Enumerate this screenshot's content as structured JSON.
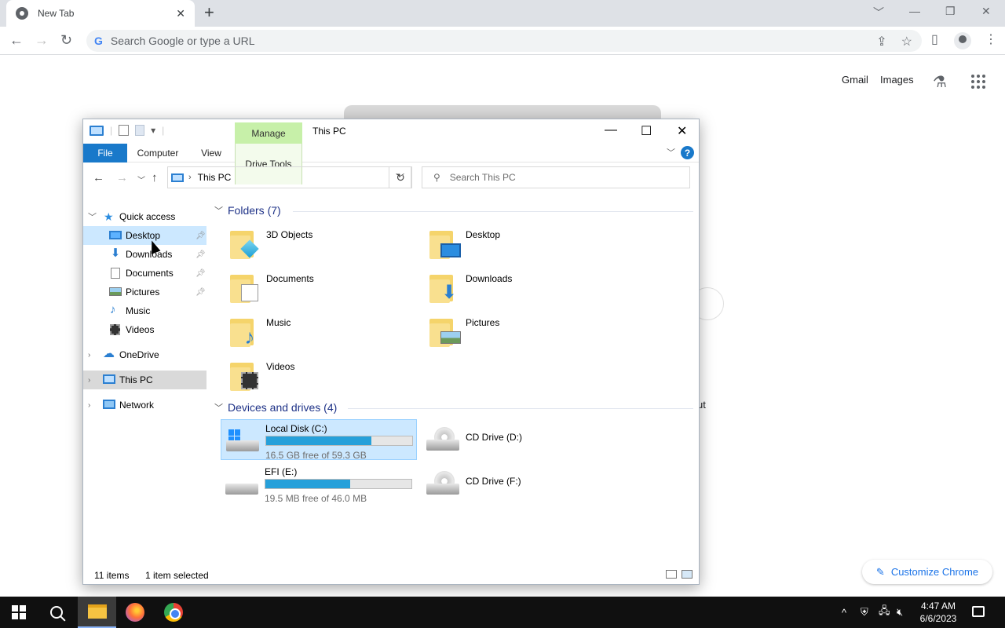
{
  "browser": {
    "tab_title": "New Tab",
    "tab_close": "✕",
    "new_tab": "+",
    "omnibox_placeholder": "Search Google or type a URL",
    "omnibox_g": "G",
    "links": {
      "gmail": "Gmail",
      "images": "Images"
    },
    "customize_label": "Customize Chrome",
    "partial_text": "ut"
  },
  "explorer": {
    "window_title": "This PC",
    "manage_tab": "Manage",
    "ribbon_tabs": {
      "file": "File",
      "computer": "Computer",
      "view": "View",
      "drive_tools": "Drive Tools"
    },
    "help": "?",
    "address": "This PC",
    "search_placeholder": "Search This PC",
    "nav": {
      "quick_access": "Quick access",
      "quick_items": [
        {
          "label": "Desktop",
          "icon": "desktop-icon",
          "pinned": true
        },
        {
          "label": "Downloads",
          "icon": "downloads-icon",
          "pinned": true
        },
        {
          "label": "Documents",
          "icon": "documents-icon",
          "pinned": true
        },
        {
          "label": "Pictures",
          "icon": "pictures-icon",
          "pinned": true
        },
        {
          "label": "Music",
          "icon": "music-icon",
          "pinned": false
        },
        {
          "label": "Videos",
          "icon": "videos-icon",
          "pinned": false
        }
      ],
      "onedrive": "OneDrive",
      "this_pc": "This PC",
      "network": "Network"
    },
    "folders_header": "Folders (7)",
    "folders": [
      {
        "name": "3D Objects",
        "icon": "3d-objects-icon"
      },
      {
        "name": "Desktop",
        "icon": "desktop-icon"
      },
      {
        "name": "Documents",
        "icon": "documents-icon"
      },
      {
        "name": "Downloads",
        "icon": "downloads-icon"
      },
      {
        "name": "Music",
        "icon": "music-icon"
      },
      {
        "name": "Pictures",
        "icon": "pictures-icon"
      },
      {
        "name": "Videos",
        "icon": "videos-icon"
      }
    ],
    "devices_header": "Devices and drives (4)",
    "drives": [
      {
        "name": "Local Disk (C:)",
        "free": "16.5 GB free of 59.3 GB",
        "used_fraction": 0.72,
        "type": "hdd-windows",
        "selected": true
      },
      {
        "name": "CD Drive (D:)",
        "type": "cd"
      },
      {
        "name": "EFI (E:)",
        "free": "19.5 MB free of 46.0 MB",
        "used_fraction": 0.58,
        "type": "hdd"
      },
      {
        "name": "CD Drive (F:)",
        "type": "cd"
      }
    ],
    "status": {
      "items": "11 items",
      "selected": "1 item selected"
    }
  },
  "taskbar": {
    "time": "4:47 AM",
    "date": "6/6/2023",
    "tray_chevron": "^"
  },
  "colors": {
    "accent": "#1979ca",
    "selection": "#cce8ff",
    "drive_bar": "#26a0da",
    "manage_green": "#c7f0a9"
  }
}
